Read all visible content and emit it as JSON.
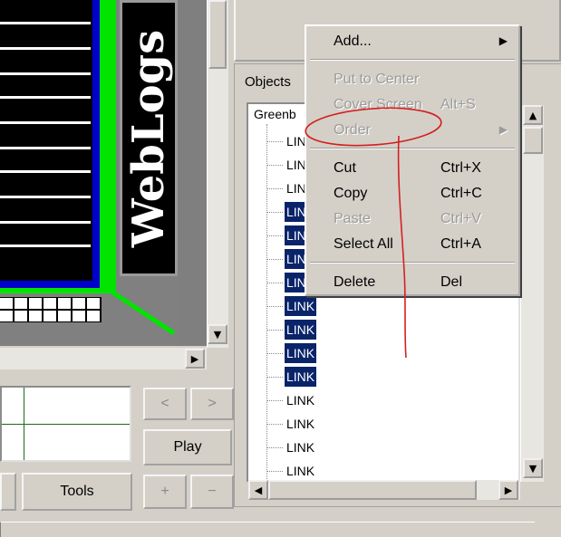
{
  "preview": {
    "banner_text": "WebLogs"
  },
  "controls": {
    "prev_label": "<",
    "next_label": ">",
    "play_label": "Play",
    "tools_label": "Tools",
    "plus_label": "+",
    "minus_label": "−"
  },
  "objects_panel": {
    "label": "Objects",
    "root": "Greenb",
    "items": [
      {
        "label": "LINK",
        "selected": false
      },
      {
        "label": "LINK",
        "selected": false
      },
      {
        "label": "LINK",
        "selected": false
      },
      {
        "label": "LINK",
        "selected": true
      },
      {
        "label": "LINK",
        "selected": true
      },
      {
        "label": "LINK",
        "selected": true
      },
      {
        "label": "LINK",
        "selected": true
      },
      {
        "label": "LINK",
        "selected": true
      },
      {
        "label": "LINK",
        "selected": true
      },
      {
        "label": "LINK",
        "selected": true
      },
      {
        "label": "LINK",
        "selected": true
      },
      {
        "label": "LINK",
        "selected": false
      },
      {
        "label": "LINK",
        "selected": false
      },
      {
        "label": "LINK",
        "selected": false
      },
      {
        "label": "LINK",
        "selected": false
      }
    ]
  },
  "context_menu": {
    "items": [
      {
        "label": "Add...",
        "shortcut": "",
        "submenu": true,
        "disabled": false
      },
      {
        "label": "Put to Center",
        "shortcut": "",
        "submenu": false,
        "disabled": true
      },
      {
        "label": "Cover Screen",
        "shortcut": "Alt+S",
        "submenu": false,
        "disabled": true
      },
      {
        "label": "Order",
        "shortcut": "",
        "submenu": true,
        "disabled": true
      },
      {
        "label": "Cut",
        "shortcut": "Ctrl+X",
        "submenu": false,
        "disabled": false
      },
      {
        "label": "Copy",
        "shortcut": "Ctrl+C",
        "submenu": false,
        "disabled": false
      },
      {
        "label": "Paste",
        "shortcut": "Ctrl+V",
        "submenu": false,
        "disabled": true
      },
      {
        "label": "Select All",
        "shortcut": "Ctrl+A",
        "submenu": false,
        "disabled": false
      },
      {
        "label": "Delete",
        "shortcut": "Del",
        "submenu": false,
        "disabled": false
      }
    ]
  },
  "colors": {
    "selection": "#0a246a",
    "annotation": "#d42020",
    "banner_green": "#00e400",
    "banner_blue": "#0000cc"
  }
}
